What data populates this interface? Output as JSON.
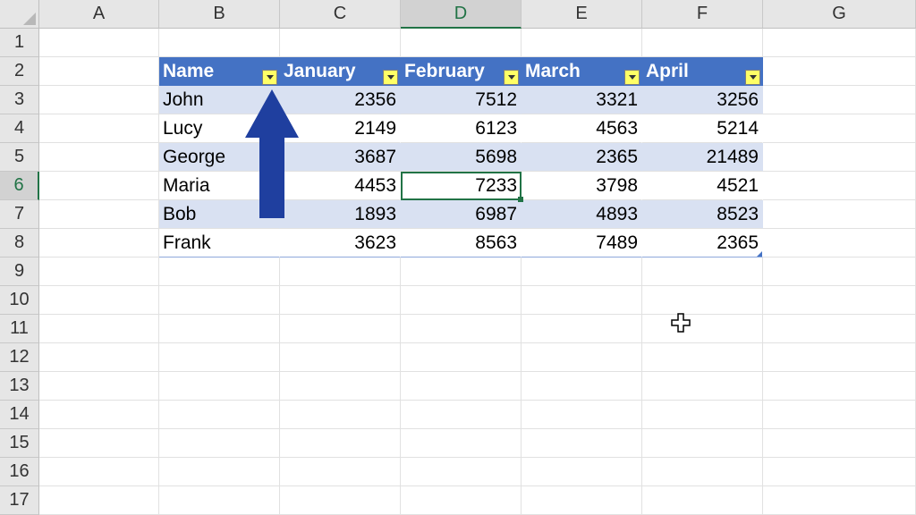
{
  "columns": [
    "A",
    "B",
    "C",
    "D",
    "E",
    "F",
    "G"
  ],
  "selected_column": "D",
  "rows": [
    "1",
    "2",
    "3",
    "4",
    "5",
    "6",
    "7",
    "8",
    "9",
    "10",
    "11",
    "12",
    "13",
    "14",
    "15",
    "16",
    "17"
  ],
  "selected_row": "6",
  "table": {
    "headers": [
      "Name",
      "January",
      "February",
      "March",
      "April"
    ],
    "data": [
      [
        "John",
        "2356",
        "7512",
        "3321",
        "3256"
      ],
      [
        "Lucy",
        "2149",
        "6123",
        "4563",
        "5214"
      ],
      [
        "George",
        "3687",
        "5698",
        "2365",
        "21489"
      ],
      [
        "Maria",
        "4453",
        "7233",
        "3798",
        "4521"
      ],
      [
        "Bob",
        "1893",
        "6987",
        "4893",
        "8523"
      ],
      [
        "Frank",
        "3623",
        "8563",
        "7489",
        "2365"
      ]
    ]
  },
  "icons": {
    "filter": "filter-dropdown-icon",
    "arrow": "up-arrow-annotation-icon",
    "cursor": "cross-cursor-icon"
  },
  "colors": {
    "table_header": "#4472c4",
    "band_row": "#d9e1f2",
    "filter_button": "#ffff66",
    "arrow": "#1f3f9f",
    "selection": "#217346"
  }
}
